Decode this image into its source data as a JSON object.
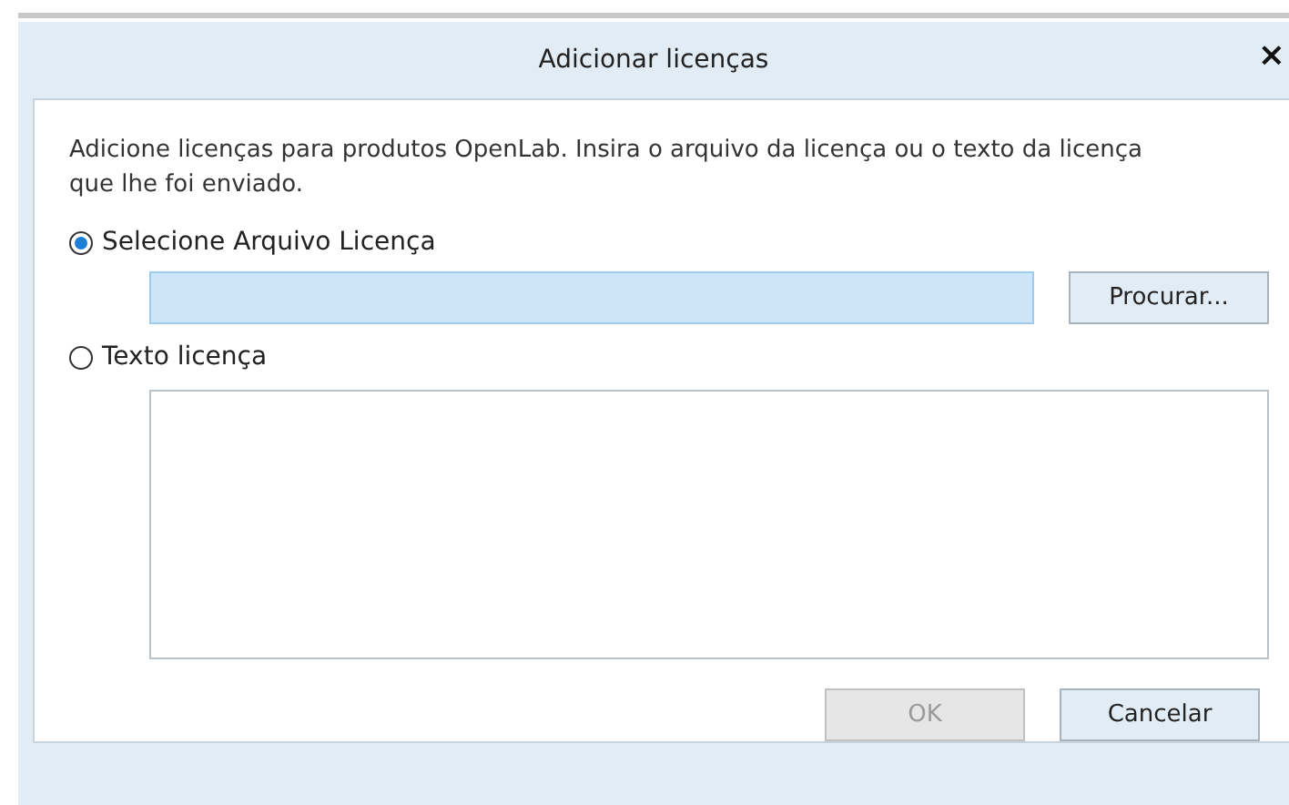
{
  "dialog": {
    "title": "Adicionar licenças",
    "close": "×"
  },
  "description": "Adicione licenças para produtos OpenLab. Insira o arquivo da licença ou o texto da licença que lhe foi enviado.",
  "options": [
    {
      "label": "Selecione Arquivo Licença",
      "selected": true
    },
    {
      "label": "Texto licença",
      "selected": false
    }
  ],
  "browse_button": {
    "label": "Procurar..."
  },
  "buttons": [
    {
      "label": "OK",
      "disabled": true
    },
    {
      "label": "Cancelar",
      "disabled": false
    }
  ]
}
